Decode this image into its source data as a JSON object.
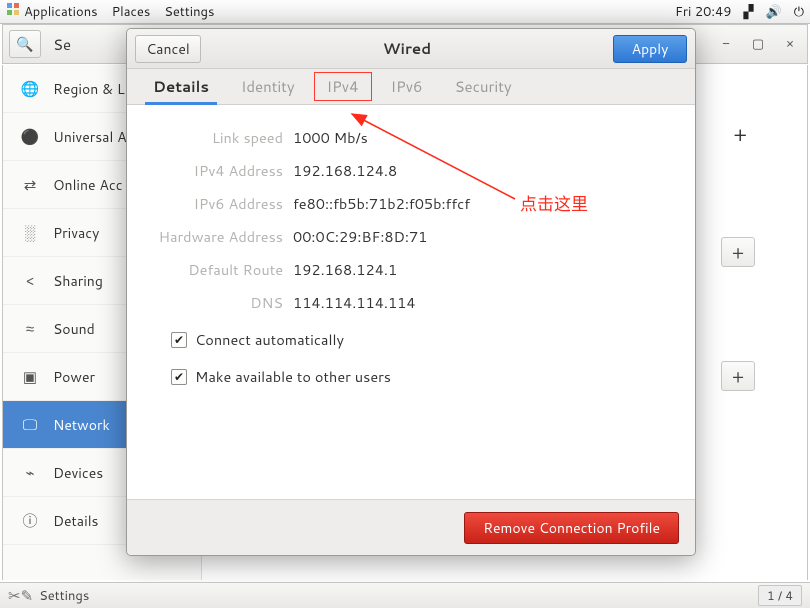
{
  "menubar": {
    "applications": "Applications",
    "places": "Places",
    "settings": "Settings",
    "clock": "Fri 20:49"
  },
  "toolbar": {
    "search_partial": "Se",
    "minimize": "−",
    "maximize": "▢",
    "close": "×"
  },
  "sidebar": {
    "items": [
      {
        "icon": "🌐",
        "label": "Region & L"
      },
      {
        "icon": "⚫",
        "label": "Universal A"
      },
      {
        "icon": "⇄",
        "label": "Online Acc"
      },
      {
        "icon": "░",
        "label": "Privacy"
      },
      {
        "icon": "<",
        "label": "Sharing"
      },
      {
        "icon": "≈",
        "label": "Sound"
      },
      {
        "icon": "▣",
        "label": "Power"
      },
      {
        "icon": "🖵",
        "label": "Network"
      },
      {
        "icon": "⌁",
        "label": "Devices"
      },
      {
        "icon": "ⓘ",
        "label": "Details"
      }
    ],
    "selected_index": 7
  },
  "dialog": {
    "cancel": "Cancel",
    "title": "Wired",
    "apply": "Apply",
    "tabs": [
      "Details",
      "Identity",
      "IPv4",
      "IPv6",
      "Security"
    ],
    "active_tab": 0,
    "highlight_tab": 2,
    "details": {
      "rows": [
        {
          "label": "Link speed",
          "value": "1000 Mb/s"
        },
        {
          "label": "IPv4 Address",
          "value": "192.168.124.8"
        },
        {
          "label": "IPv6 Address",
          "value": "fe80::fb5b:71b2:f05b:ffcf"
        },
        {
          "label": "Hardware Address",
          "value": "00:0C:29:BF:8D:71"
        },
        {
          "label": "Default Route",
          "value": "192.168.124.1"
        },
        {
          "label": "DNS",
          "value": "114.114.114.114"
        }
      ],
      "auto": "Connect automatically",
      "avail": "Make available to other users"
    },
    "remove": "Remove Connection Profile"
  },
  "annotation": {
    "text": "点击这里"
  },
  "statusbar": {
    "label": "Settings",
    "page": "1 / 4"
  }
}
